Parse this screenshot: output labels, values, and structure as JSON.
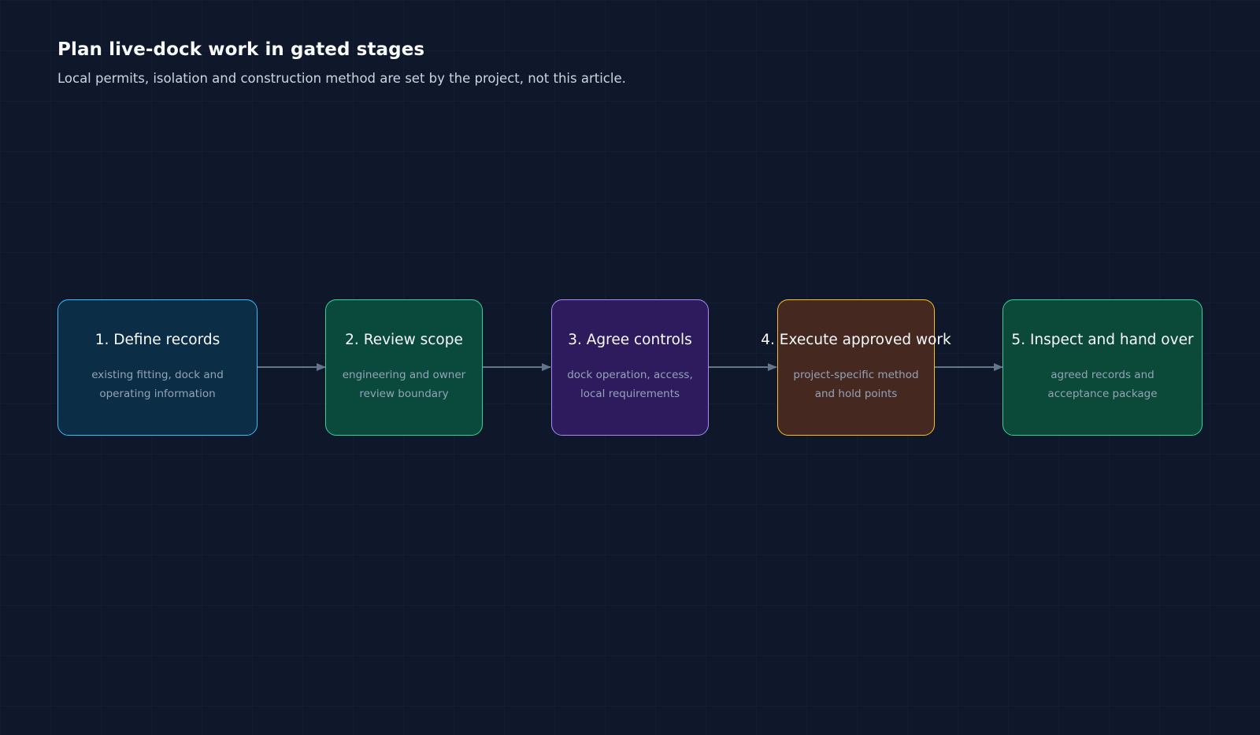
{
  "header": {
    "title": "Plan live-dock work in gated stages",
    "subtitle": "Local permits, isolation and construction method are set by the project, not this article."
  },
  "stages": [
    {
      "title": "1. Define records",
      "desc": [
        "existing fitting, dock and",
        "operating information"
      ],
      "border": "#38bdf8",
      "fill": "#0c2d46"
    },
    {
      "title": "2. Review scope",
      "desc": [
        "engineering and owner",
        "review boundary"
      ],
      "border": "#34d399",
      "fill": "#0a4a3c"
    },
    {
      "title": "3. Agree controls",
      "desc": [
        "dock operation, access,",
        "local requirements"
      ],
      "border": "#a78bfa",
      "fill": "#2e1b5e"
    },
    {
      "title": "4. Execute approved work",
      "desc": [
        "project-specific method",
        "and hold points"
      ],
      "border": "#fbbf24",
      "fill": "#452820"
    },
    {
      "title": "5. Inspect and hand over",
      "desc": [
        "agreed records and",
        "acceptance package"
      ],
      "border": "#34d399",
      "fill": "#0b4a38"
    }
  ],
  "colors": {
    "background": "#0f172a",
    "arrow": "#64748b"
  }
}
